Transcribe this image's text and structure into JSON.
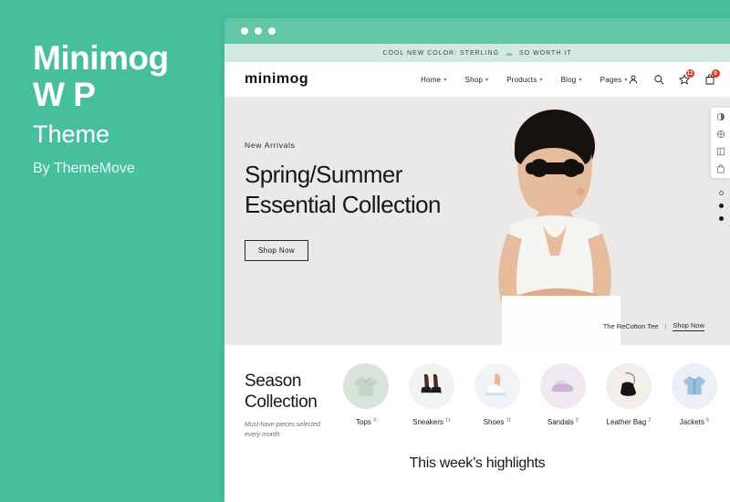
{
  "promo": {
    "title_line1": "Minimog",
    "title_line2": "W P",
    "subtitle": "Theme",
    "author": "By ThemeMove",
    "bg_color": "#48bf9b"
  },
  "mobile_preview": {
    "announcement": "COOL NEW COLOR: STERLING",
    "announcement_tail": "SO",
    "add_label": "+",
    "logo": "minimog",
    "cart_badge": "0",
    "eyebrow": "New Arrivals",
    "headline": "Spring/Summer Essential",
    "slider_dots": 3,
    "active_dot": 1
  },
  "browser": {
    "announcement": "COOL NEW COLOR: STERLING",
    "announcement_tail": "SO WORTH IT",
    "logo": "minimog",
    "menu": [
      {
        "label": "Home"
      },
      {
        "label": "Shop"
      },
      {
        "label": "Products"
      },
      {
        "label": "Blog"
      },
      {
        "label": "Pages"
      }
    ],
    "wishlist_badge": "12",
    "cart_badge": "0",
    "hero": {
      "eyebrow": "New Arrivals",
      "headline_line1": "Spring/Summer",
      "headline_line2": "Essential Collection",
      "cta": "Shop Now",
      "caption_product": "The ReCotton Tee",
      "caption_sep": "|",
      "caption_link": "Shop Now"
    },
    "season": {
      "title_line1": "Season",
      "title_line2": "Collection",
      "subtitle_line1": "Must-have pieces selected",
      "subtitle_line2": "every month",
      "categories": [
        {
          "name": "Tops",
          "count": "3",
          "color": "#d7e4d9"
        },
        {
          "name": "Sneakers",
          "count": "11",
          "color": "#f2f2f2"
        },
        {
          "name": "Shoes",
          "count": "11",
          "color": "#f1f3f5"
        },
        {
          "name": "Sandals",
          "count": "2",
          "color": "#f0e9f0"
        },
        {
          "name": "Leather Bag",
          "count": "2",
          "color": "#f2efe9"
        },
        {
          "name": "Jackets",
          "count": "5",
          "color": "#eaf0f6"
        }
      ]
    },
    "highlights_title": "This week’s highlights"
  },
  "colors": {
    "brand_teal": "#48bf9b",
    "chrome_teal": "#63c6a6",
    "announce_mint": "#d2e9df",
    "hero_grey": "#eae9e7",
    "badge_red": "#e8322a"
  }
}
